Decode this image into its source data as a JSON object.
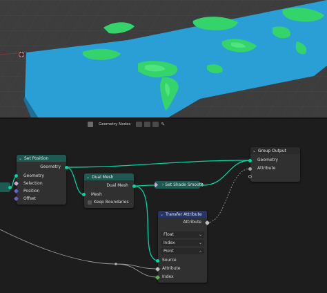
{
  "editor": {
    "title": "Geometry Nodes"
  },
  "nodes": {
    "set_position": {
      "title": "Set Position",
      "output_geometry": "Geometry",
      "input_geometry": "Geometry",
      "input_selection": "Selection",
      "input_position": "Position",
      "input_offset": "Offset"
    },
    "dual_mesh": {
      "title": "Dual Mesh",
      "output_dual_mesh": "Dual Mesh",
      "input_mesh": "Mesh",
      "keep_boundaries": "Keep Boundaries"
    },
    "set_shade_smooth": {
      "title": "Set Shade Smooth"
    },
    "group_output": {
      "title": "Group Output",
      "input_geometry": "Geometry",
      "input_attribute": "Attribute"
    },
    "transfer_attribute": {
      "title": "Transfer Attribute",
      "output_attribute": "Attribute",
      "data_type": "Float",
      "mapping": "Index",
      "domain": "Point",
      "input_source": "Source",
      "input_attribute": "Attribute",
      "input_index": "Index"
    }
  },
  "colors": {
    "viewport_bg": "#3d3d3d",
    "terrain_water": "#2a9fd6",
    "terrain_land": "#35d46a",
    "geometry_socket": "#00d6a3",
    "node_bg": "#303030",
    "header_geometry": "#1e5a52",
    "header_attribute": "#273566"
  }
}
